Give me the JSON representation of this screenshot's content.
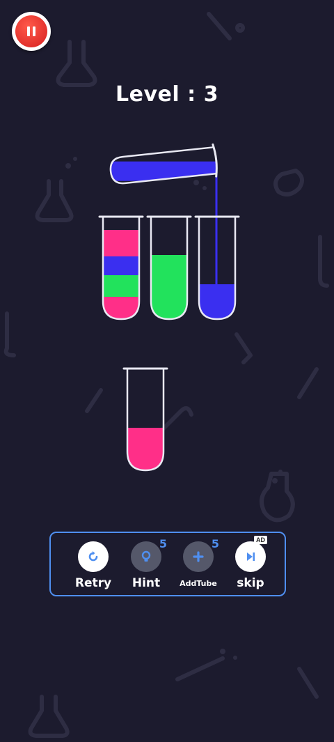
{
  "level": {
    "title": "Level : 3"
  },
  "colors": {
    "background": "#1c1b2e",
    "pink": "#ff2f88",
    "blue": "#3a2ff0",
    "green": "#22e25c",
    "accent": "#4f8ff0",
    "pause": "#e32525"
  },
  "tubes": [
    {
      "name": "tube-1",
      "layers": [
        "pink",
        "blue",
        "green",
        "pink"
      ]
    },
    {
      "name": "tube-2",
      "layers": [
        "green",
        "green",
        "green"
      ]
    },
    {
      "name": "tube-3",
      "layers": [
        "blue"
      ]
    },
    {
      "name": "tube-4",
      "layers": [
        "pink"
      ]
    },
    {
      "name": "pouring-tube",
      "layers": [
        "blue"
      ]
    }
  ],
  "toolbar": {
    "retry": {
      "label": "Retry",
      "icon": "retry-icon"
    },
    "hint": {
      "label": "Hint",
      "icon": "lightbulb-icon",
      "count": "5"
    },
    "add_tube": {
      "label": "AddTube",
      "icon": "plus-icon",
      "count": "5"
    },
    "skip": {
      "label": "skip",
      "icon": "skip-icon",
      "badge": "AD"
    }
  },
  "pause": {
    "icon": "pause-icon"
  }
}
